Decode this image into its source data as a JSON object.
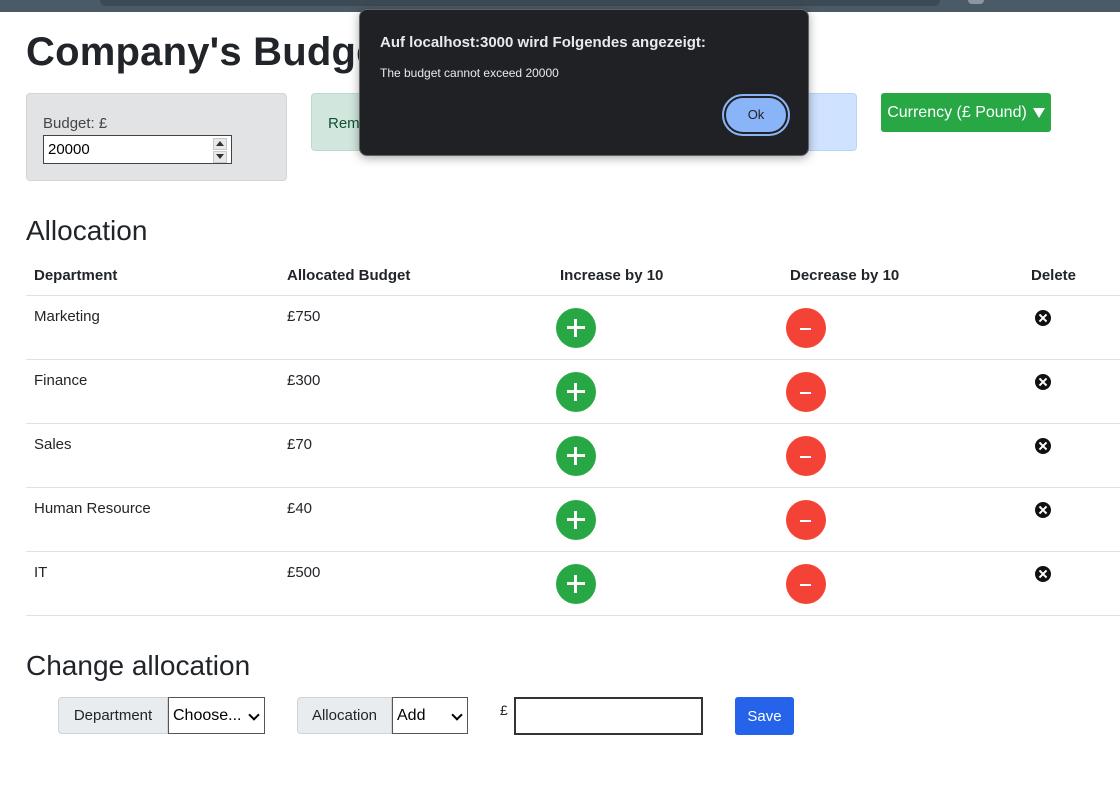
{
  "page": {
    "title": "Company's Budget"
  },
  "budget": {
    "label": "Budget: £",
    "value": "20000"
  },
  "remaining": {
    "label_fragment": "Rem"
  },
  "currency": {
    "label": "Currency (£ Pound)"
  },
  "allocation": {
    "title": "Allocation",
    "headers": [
      "Department",
      "Allocated Budget",
      "Increase by 10",
      "Decrease by 10",
      "Delete"
    ],
    "rows": [
      {
        "department": "Marketing",
        "budget": "£750"
      },
      {
        "department": "Finance",
        "budget": "£300"
      },
      {
        "department": "Sales",
        "budget": "£70"
      },
      {
        "department": "Human Resource",
        "budget": "£40"
      },
      {
        "department": "IT",
        "budget": "£500"
      }
    ]
  },
  "change": {
    "title": "Change allocation",
    "department_label": "Department",
    "department_select": "Choose...",
    "allocation_label": "Allocation",
    "allocation_select": "Add",
    "currency_symbol": "£",
    "amount_value": "",
    "save_label": "Save"
  },
  "dialog": {
    "title": "Auf localhost:3000 wird Folgendes angezeigt:",
    "message": "The budget cannot exceed 20000",
    "ok_label": "Ok"
  },
  "colors": {
    "increase": "#28a745",
    "decrease": "#f44336",
    "save": "#2563eb",
    "dialog_bg": "#202124",
    "ok_button": "#8ab4f8"
  }
}
